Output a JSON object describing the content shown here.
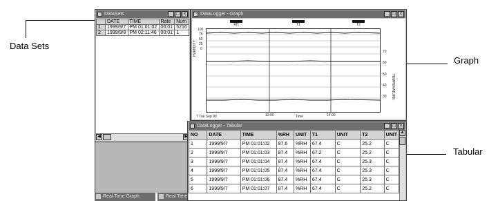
{
  "callouts": {
    "data_sets": "Data Sets",
    "graph": "Graph",
    "tabular": "Tabular"
  },
  "datasets_window": {
    "title": "DataSets",
    "columns": [
      "",
      "DATE",
      "TIME",
      "Rate",
      "Num"
    ],
    "rows": [
      [
        "1",
        "1999/9/7",
        "PM 01:01:02",
        "00:01",
        "5216"
      ],
      [
        "2",
        "1999/9/8",
        "PM 02:11:46",
        "00:01",
        "1"
      ]
    ]
  },
  "graph_window": {
    "title": "DataLogger - Graph",
    "legend": [
      "RH",
      "T1",
      "T2"
    ],
    "left_axis_label": "HUMIDITY",
    "right_axis_label": "TEMPERATURE",
    "left_ticks": [
      "100",
      "75",
      "50",
      "25",
      "0"
    ],
    "right_ticks": [
      "70",
      "60",
      "50",
      "40",
      "30"
    ],
    "x_ticks": [
      "13:00",
      "14:00"
    ],
    "x_date": "7 Tue Sep 99",
    "x_label": "Time"
  },
  "tabular_window": {
    "title": "DataLogger - Tabular",
    "columns": [
      "NO",
      "DATE",
      "TIME",
      "%RH",
      "UNIT",
      "T1",
      "UNIT",
      "T2",
      "UNIT"
    ],
    "rows": [
      [
        "1",
        "1999/9/7",
        "PM 01:01:02",
        "87.6",
        "%RH",
        "67.4",
        "C",
        "25.2",
        "C"
      ],
      [
        "2",
        "1999/9/7",
        "PM 01:01:03",
        "87.4",
        "%RH",
        "67.2",
        "C",
        "25.2",
        "C"
      ],
      [
        "3",
        "1999/9/7",
        "PM 01:01:04",
        "87.4",
        "%RH",
        "67.4",
        "C",
        "25.3",
        "C"
      ],
      [
        "4",
        "1999/9/7",
        "PM 01:01:05",
        "87.4",
        "%RH",
        "67.4",
        "C",
        "25.3",
        "C"
      ],
      [
        "5",
        "1999/9/7",
        "PM 01:01:06",
        "87.4",
        "%RH",
        "67.4",
        "C",
        "25.3",
        "C"
      ],
      [
        "6",
        "1999/9/7",
        "PM 01:01:07",
        "87.4",
        "%RH",
        "67.4",
        "C",
        "25.2",
        "C"
      ]
    ]
  },
  "taskbar": {
    "item1": "Real Time Graph",
    "item2": "Real Time"
  },
  "colors": {
    "titlebar": "#6e6e6e",
    "window": "#c0c0c0",
    "panel": "#b8b8b8"
  }
}
